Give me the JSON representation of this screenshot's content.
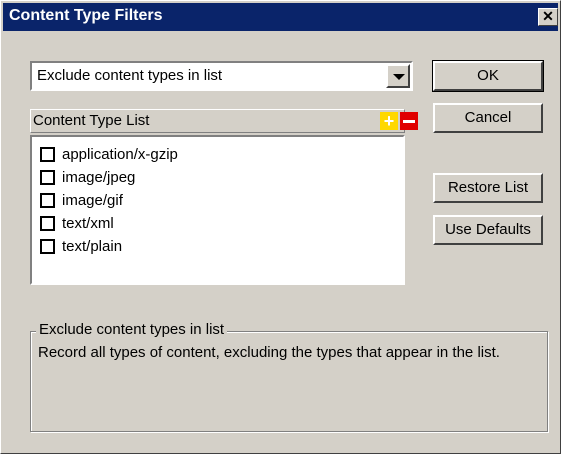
{
  "window": {
    "title": "Content Type Filters",
    "close_glyph": "✕"
  },
  "filter_mode": {
    "selected": "Exclude content types in list"
  },
  "list": {
    "header": "Content Type List",
    "add_glyph": "+",
    "items": [
      {
        "label": "application/x-gzip",
        "checked": false
      },
      {
        "label": "image/jpeg",
        "checked": false
      },
      {
        "label": "image/gif",
        "checked": false
      },
      {
        "label": "text/xml",
        "checked": false
      },
      {
        "label": "text/plain",
        "checked": false
      }
    ]
  },
  "buttons": {
    "ok": "OK",
    "cancel": "Cancel",
    "restore": "Restore List",
    "defaults": "Use Defaults"
  },
  "description": {
    "title": "Exclude content types in list",
    "text": "Record all types of content, excluding the types that appear in the list."
  },
  "colors": {
    "titlebar": "#0a246a",
    "dialog_bg": "#d4d0c8",
    "add_button": "#ffd800",
    "remove_button": "#e00000"
  }
}
